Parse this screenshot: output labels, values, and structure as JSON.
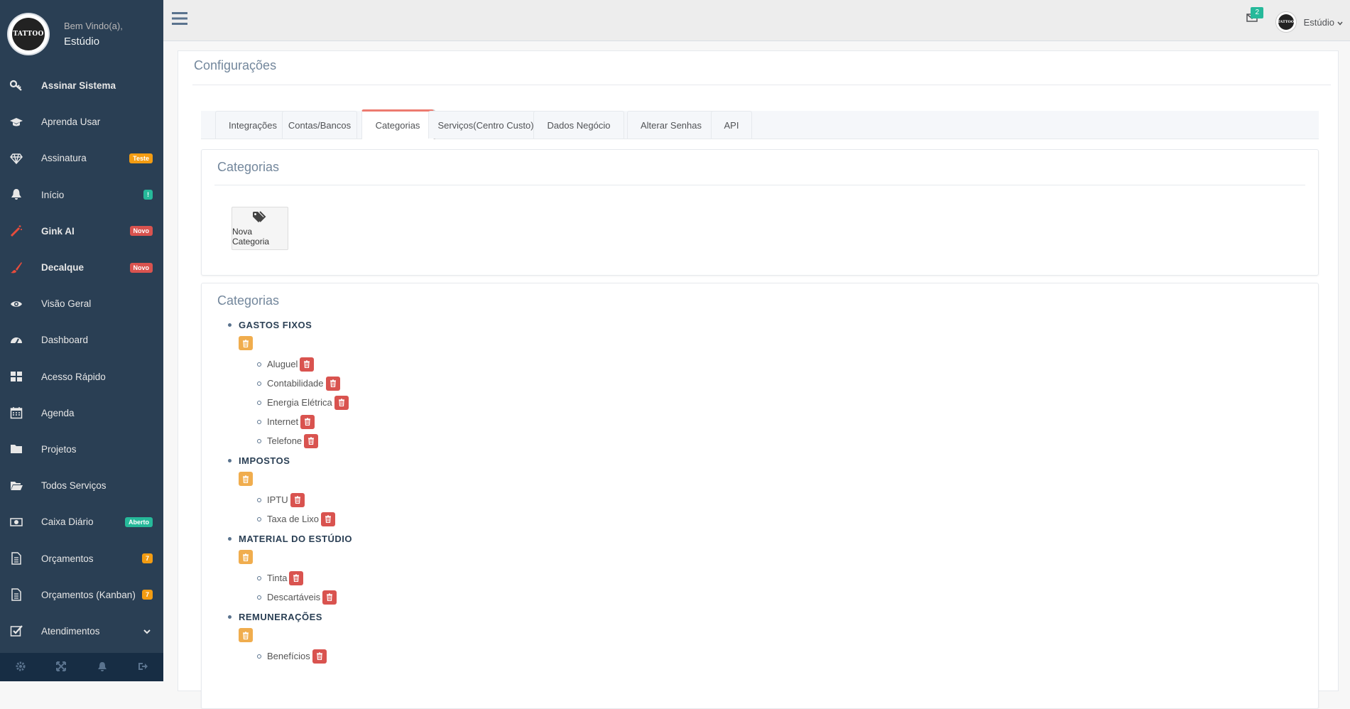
{
  "sidebar": {
    "logo_text": "TATTOO",
    "welcome_line1": "Bem Vindo(a),",
    "welcome_line2": "Estúdio",
    "items": [
      {
        "label": "Assinar Sistema",
        "icon": "key-icon",
        "bold": true
      },
      {
        "label": "Aprenda Usar",
        "icon": "graduation-cap-icon"
      },
      {
        "label": "Assinatura",
        "icon": "diamond-icon",
        "badge": "Teste",
        "badge_color": "#F39C12"
      },
      {
        "label": "Início",
        "icon": "bell-icon",
        "badge": "!",
        "badge_color": "#26B99A"
      },
      {
        "label": "Gink AI",
        "icon": "magic-wand-icon",
        "badge": "Novo",
        "badge_color": "#D9534F",
        "bold": true
      },
      {
        "label": "Decalque",
        "icon": "brush-icon",
        "badge": "Novo",
        "badge_color": "#D9534F",
        "bold": true
      },
      {
        "label": "Visão Geral",
        "icon": "eye-icon"
      },
      {
        "label": "Dashboard",
        "icon": "dashboard-icon"
      },
      {
        "label": "Acesso Rápido",
        "icon": "grid-icon"
      },
      {
        "label": "Agenda",
        "icon": "calendar-icon"
      },
      {
        "label": "Projetos",
        "icon": "folder-icon"
      },
      {
        "label": "Todos Serviços",
        "icon": "folder-open-icon"
      },
      {
        "label": "Caixa Diário",
        "icon": "money-icon",
        "badge": "Aberto",
        "badge_color": "#26B99A"
      },
      {
        "label": "Orçamentos",
        "icon": "file-text-icon",
        "badge": "7",
        "badge_color": "#F39C12"
      },
      {
        "label": "Orçamentos (Kanban)",
        "icon": "file-text-icon",
        "badge": "7",
        "badge_color": "#F39C12"
      },
      {
        "label": "Atendimentos",
        "icon": "check-square-icon",
        "chevron": true
      }
    ],
    "footer_icons": [
      "gear-icon",
      "fullscreen-icon",
      "bell-icon",
      "logout-icon"
    ]
  },
  "topnav": {
    "mail_count": "2",
    "user_name": "Estúdio"
  },
  "page": {
    "title": "Configurações",
    "tabs": [
      "Integrações",
      "Contas/Bancos",
      "Categorias",
      "Serviços(Centro Custo)",
      "Dados Negócio",
      "Alterar Senhas",
      "API"
    ],
    "active_tab": "Categorias"
  },
  "new_category_box": {
    "title": "Categorias",
    "button_label": "Nova Categoria"
  },
  "categories_box": {
    "title": "Categorias",
    "categories": [
      {
        "name": "GASTOS FIXOS",
        "items": [
          "Aluguel",
          "Contabilidade",
          "Energia Elétrica",
          "Internet",
          "Telefone"
        ]
      },
      {
        "name": "IMPOSTOS",
        "items": [
          "IPTU",
          "Taxa de Lixo"
        ]
      },
      {
        "name": "MATERIAL DO ESTÚDIO",
        "items": [
          "Tinta",
          "Descartáveis"
        ]
      },
      {
        "name": "REMUNERAÇÕES",
        "items": [
          "Benefícios"
        ]
      }
    ]
  },
  "colors": {
    "sidebar_bg": "#2A3F54",
    "active_tab_accent": "#ED7A6F",
    "edit_button": "#F0AD4E",
    "delete_button": "#D9534F"
  }
}
